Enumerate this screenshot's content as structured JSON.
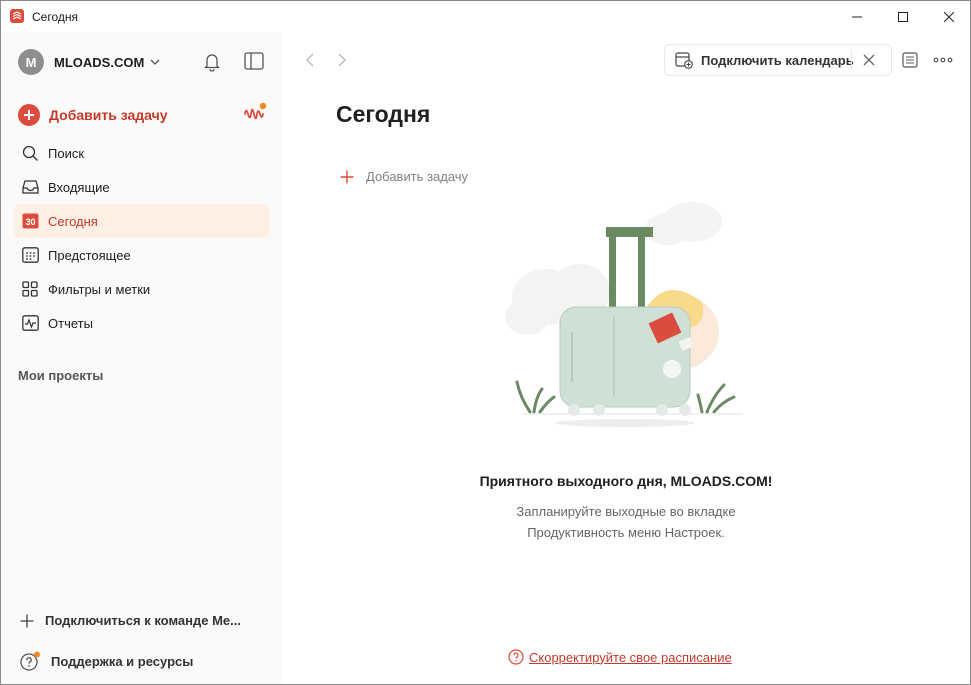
{
  "window": {
    "title": "Сегодня"
  },
  "sidebar": {
    "profile": {
      "initial": "M",
      "name": "MLOADS.COM"
    },
    "add_task_label": "Добавить задачу",
    "items": [
      {
        "label": "Поиск",
        "icon": "search-icon"
      },
      {
        "label": "Входящие",
        "icon": "inbox-icon"
      },
      {
        "label": "Сегодня",
        "icon": "calendar-today-icon",
        "badge": "30",
        "active": true
      },
      {
        "label": "Предстоящее",
        "icon": "calendar-grid-icon"
      },
      {
        "label": "Фильтры и метки",
        "icon": "filters-icon"
      },
      {
        "label": "Отчеты",
        "icon": "reports-icon"
      }
    ],
    "projects_heading": "Мои проекты",
    "join_team_label": "Подключиться к команде Me...",
    "support_label": "Поддержка и ресурсы"
  },
  "main": {
    "connect_calendar_label": "Подключить календарь",
    "page_title": "Сегодня",
    "inline_add_label": "Добавить задачу",
    "empty_title": "Приятного выходного дня, MLOADS.COM!",
    "empty_line1": "Запланируйте выходные во вкладке",
    "empty_line2": "Продуктивность меню Настроек.",
    "adjust_schedule_label": "Скорректируйте свое расписание"
  },
  "colors": {
    "accent": "#dc4c3e",
    "accent_text": "#c3392c",
    "active_bg": "#ffefe5",
    "sidebar_bg": "#fcfaf8",
    "notification_dot": "#f0891f"
  }
}
